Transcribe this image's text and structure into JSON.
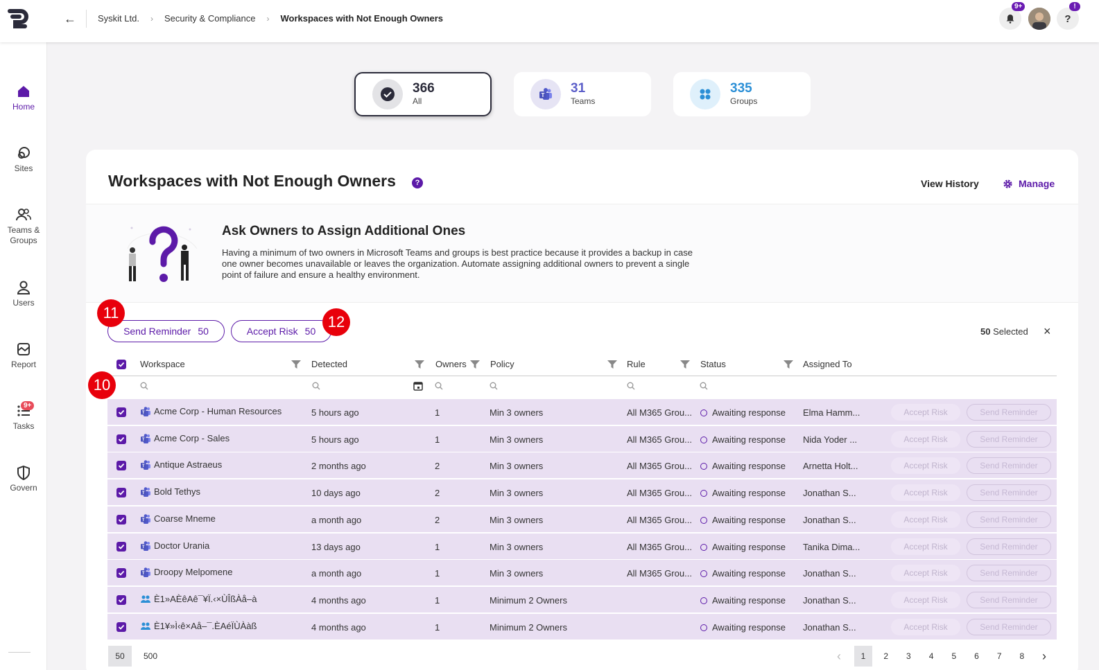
{
  "breadcrumb": {
    "items": [
      "Syskit Ltd.",
      "Security & Compliance"
    ],
    "current": "Workspaces with Not Enough Owners"
  },
  "topbar": {
    "notification_badge": "9+",
    "help_badge": "!"
  },
  "sidebar": {
    "items": [
      {
        "label": "Home",
        "icon": "home-icon"
      },
      {
        "label": "Sites",
        "icon": "sites-icon"
      },
      {
        "label": "Teams &",
        "label2": "Groups",
        "icon": "teams-groups-icon"
      },
      {
        "label": "Users",
        "icon": "users-icon"
      },
      {
        "label": "Report",
        "icon": "report-icon"
      },
      {
        "label": "Tasks",
        "icon": "tasks-icon",
        "badge": "9+"
      },
      {
        "label": "Govern",
        "icon": "govern-icon"
      }
    ]
  },
  "cards": [
    {
      "value": "366",
      "label": "All"
    },
    {
      "value": "31",
      "label": "Teams"
    },
    {
      "value": "335",
      "label": "Groups"
    }
  ],
  "panel": {
    "title": "Workspaces with Not Enough Owners",
    "help": "?",
    "view_history": "View History",
    "manage": "Manage"
  },
  "info": {
    "title": "Ask Owners to Assign Additional Ones",
    "text": "Having a minimum of two owners in Microsoft Teams and groups is best practice because it provides a backup in case one owner becomes unavailable or leaves the organization. Automate assigning additional owners to prevent a single point of failure and ensure a healthy environment."
  },
  "actions": {
    "send_reminder": "Send Reminder",
    "send_reminder_count": "50",
    "accept_risk": "Accept Risk",
    "accept_risk_count": "50",
    "selected_count": "50",
    "selected_label": "Selected",
    "clear": "×"
  },
  "table": {
    "columns": [
      "Workspace",
      "Detected",
      "Owners",
      "Policy",
      "Rule",
      "Status",
      "Assigned To"
    ],
    "row_action_risk": "Accept Risk",
    "row_action_reminder": "Send Reminder",
    "rows": [
      {
        "type": "teams",
        "workspace": "Acme Corp - Human Resources",
        "detected": "5 hours ago",
        "owners": "1",
        "policy": "Min 3 owners",
        "rule": "All M365 Grou...",
        "status": "Awaiting response",
        "assigned": "Elma Hamm..."
      },
      {
        "type": "teams",
        "workspace": "Acme Corp - Sales",
        "detected": "5 hours ago",
        "owners": "1",
        "policy": "Min 3 owners",
        "rule": "All M365 Grou...",
        "status": "Awaiting response",
        "assigned": "Nida Yoder ..."
      },
      {
        "type": "teams",
        "workspace": "Antique Astraeus",
        "detected": "2 months ago",
        "owners": "2",
        "policy": "Min 3 owners",
        "rule": "All M365 Grou...",
        "status": "Awaiting response",
        "assigned": "Arnetta Holt..."
      },
      {
        "type": "teams",
        "workspace": "Bold Tethys",
        "detected": "10 days ago",
        "owners": "2",
        "policy": "Min 3 owners",
        "rule": "All M365 Grou...",
        "status": "Awaiting response",
        "assigned": "Jonathan S..."
      },
      {
        "type": "teams",
        "workspace": "Coarse Mneme",
        "detected": "a month ago",
        "owners": "2",
        "policy": "Min 3 owners",
        "rule": "All M365 Grou...",
        "status": "Awaiting response",
        "assigned": "Jonathan S..."
      },
      {
        "type": "teams",
        "workspace": "Doctor Urania",
        "detected": "13 days ago",
        "owners": "1",
        "policy": "Min 3 owners",
        "rule": "All M365 Grou...",
        "status": "Awaiting response",
        "assigned": "Tanika Dima..."
      },
      {
        "type": "teams",
        "workspace": "Droopy Melpomene",
        "detected": "a month ago",
        "owners": "1",
        "policy": "Min 3 owners",
        "rule": "All M365 Grou...",
        "status": "Awaiting response",
        "assigned": "Jonathan S..."
      },
      {
        "type": "group",
        "workspace": "È1»AÈêAê¯¥Ï.‹×ÙÎßÀå–à",
        "detected": "4 months ago",
        "owners": "1",
        "policy": "Minimum 2 Owners",
        "rule": "",
        "status": "Awaiting response",
        "assigned": "Jonathan S..."
      },
      {
        "type": "group",
        "workspace": "È1¥»Ì‹ê×Aå–¯.ÈAéÏÙÀàß",
        "detected": "4 months ago",
        "owners": "1",
        "policy": "Minimum 2 Owners",
        "rule": "",
        "status": "Awaiting response",
        "assigned": "Jonathan S..."
      }
    ]
  },
  "pagination": {
    "sizes": [
      "50",
      "500"
    ],
    "pages": [
      "1",
      "2",
      "3",
      "4",
      "5",
      "6",
      "7",
      "8"
    ],
    "current": "1"
  },
  "markers": [
    "10",
    "11",
    "12"
  ],
  "colors": {
    "accent": "#5c1aa8",
    "row_selected": "#e9dff2",
    "marker": "#e8000b"
  }
}
